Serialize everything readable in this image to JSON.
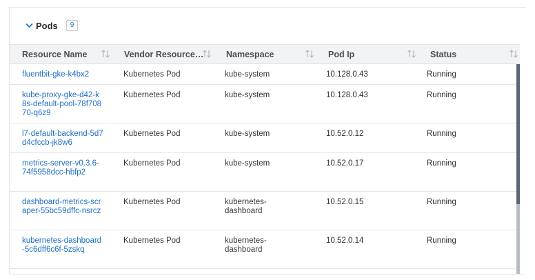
{
  "panel": {
    "title": "Pods",
    "count": "9"
  },
  "columns": [
    {
      "label": "Resource Name"
    },
    {
      "label": "Vendor Resource…"
    },
    {
      "label": "Namespace"
    },
    {
      "label": "Pod Ip"
    },
    {
      "label": "Status"
    }
  ],
  "rows": [
    {
      "name": "fluentbit-gke-k4bx2",
      "vendor": "Kubernetes Pod",
      "namespace": "kube-system",
      "ip": "10.128.0.43",
      "status": "Running"
    },
    {
      "name": "kube-proxy-gke-d42-k8s-default-pool-78f70870-q6z9",
      "vendor": "Kubernetes Pod",
      "namespace": "kube-system",
      "ip": "10.128.0.43",
      "status": "Running"
    },
    {
      "name": "l7-default-backend-5d7d4cfccb-jk8w6",
      "vendor": "Kubernetes Pod",
      "namespace": "kube-system",
      "ip": "10.52.0.12",
      "status": "Running"
    },
    {
      "name": "metrics-server-v0.3.6-74f5958dcc-hbfp2",
      "vendor": "Kubernetes Pod",
      "namespace": "kube-system",
      "ip": "10.52.0.17",
      "status": "Running"
    },
    {
      "name": "dashboard-metrics-scraper-55bc59dffc-nsrcz",
      "vendor": "Kubernetes Pod",
      "namespace": "kubernetes-dashboard",
      "ip": "10.52.0.15",
      "status": "Running"
    },
    {
      "name": "kubernetes-dashboard-5c6dff6c6f-5zskq",
      "vendor": "Kubernetes Pod",
      "namespace": "kubernetes-dashboard",
      "ip": "10.52.0.14",
      "status": "Running"
    }
  ],
  "icons": {
    "collapse": "chevron-down-icon",
    "sort": "sort-arrows-icon"
  },
  "colors": {
    "link": "#1f6fc5",
    "header_bg": "#f2f3f5",
    "scroll_thumb": "#5d6673"
  }
}
